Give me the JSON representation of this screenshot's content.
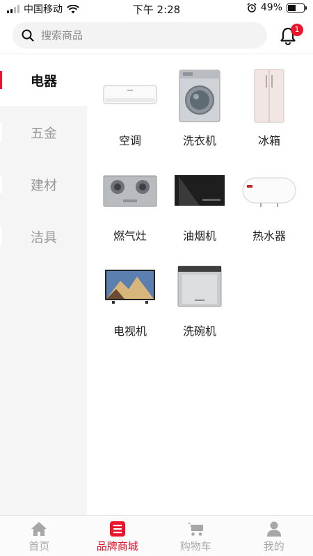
{
  "status_bar": {
    "carrier": "中国移动",
    "time": "下午 2:28",
    "battery": "49%",
    "battery_level": 0.49
  },
  "header": {
    "search_placeholder": "搜索商品",
    "notification_count": "1"
  },
  "sidebar": {
    "items": [
      {
        "label": "电器",
        "active": true
      },
      {
        "label": "五金",
        "active": false
      },
      {
        "label": "建材",
        "active": false
      },
      {
        "label": "洁具",
        "active": false
      }
    ]
  },
  "products": [
    {
      "label": "空调",
      "icon": "air-conditioner"
    },
    {
      "label": "洗衣机",
      "icon": "washing-machine"
    },
    {
      "label": "冰箱",
      "icon": "refrigerator"
    },
    {
      "label": "燃气灶",
      "icon": "gas-stove"
    },
    {
      "label": "油烟机",
      "icon": "range-hood"
    },
    {
      "label": "热水器",
      "icon": "water-heater"
    },
    {
      "label": "电视机",
      "icon": "television"
    },
    {
      "label": "洗碗机",
      "icon": "dishwasher"
    }
  ],
  "tabbar": {
    "items": [
      {
        "label": "首页",
        "icon": "home-icon"
      },
      {
        "label": "品牌商城",
        "icon": "list-icon",
        "active": true
      },
      {
        "label": "购物车",
        "icon": "cart-icon"
      },
      {
        "label": "我的",
        "icon": "user-icon"
      }
    ]
  },
  "colors": {
    "accent": "#e8152d",
    "sidebar_bg": "#f5f5f5",
    "inactive_text": "#9a9a9a"
  }
}
